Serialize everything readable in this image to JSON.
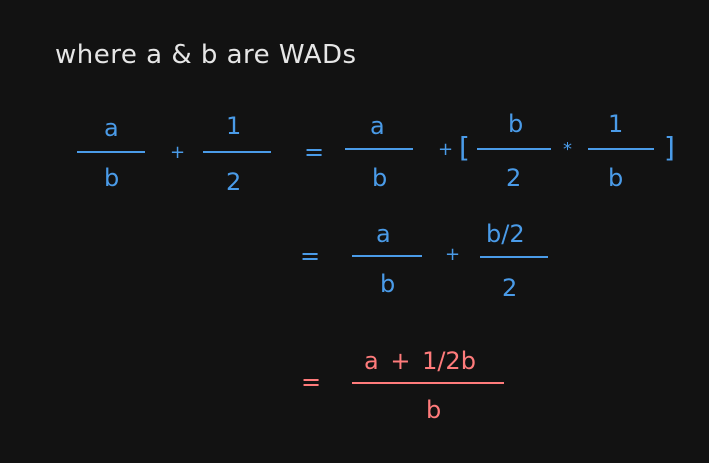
{
  "heading": "where a & b are WADs",
  "colors": {
    "background": "#121212",
    "text": "#e6e6e6",
    "math": "#4a9be8",
    "result": "#ff7b7b"
  },
  "math": {
    "row1": {
      "frac1": {
        "num": "a",
        "den": "b"
      },
      "plus1": "+",
      "frac2": {
        "num": "1",
        "den": "2"
      },
      "eq": "=",
      "frac3": {
        "num": "a",
        "den": "b"
      },
      "plus2": "+",
      "lbracket": "[",
      "frac4": {
        "num": "b",
        "den": "2"
      },
      "times": "*",
      "frac5": {
        "num": "1",
        "den": "b"
      },
      "rbracket": "]"
    },
    "row2": {
      "eq": "=",
      "frac1": {
        "num": "a",
        "den": "b"
      },
      "plus": "+",
      "frac2": {
        "num": "b/2",
        "den": "2"
      }
    },
    "row3": {
      "eq": "=",
      "frac": {
        "num": "a + 1/2b",
        "den": "b"
      }
    }
  }
}
